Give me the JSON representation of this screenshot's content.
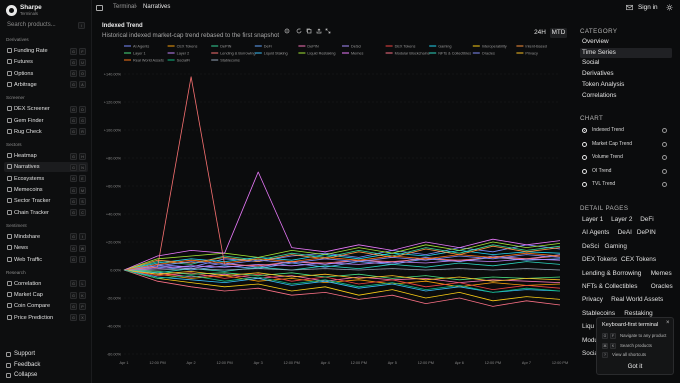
{
  "app": {
    "brand": "Sharpe",
    "brand_sub": "Terminals",
    "search_placeholder": "Search products...",
    "search_kbd": "/"
  },
  "sidebar": {
    "sections": [
      {
        "title": "Derivatives",
        "items": [
          {
            "label": "Funding Rate",
            "k1": "G",
            "k2": "F"
          },
          {
            "label": "Futures",
            "k1": "G",
            "k2": "U"
          },
          {
            "label": "Options",
            "k1": "G",
            "k2": "O"
          },
          {
            "label": "Arbitrage",
            "k1": "G",
            "k2": "A"
          }
        ]
      },
      {
        "title": "Screener",
        "items": [
          {
            "label": "DEX Screener",
            "k1": "G",
            "k2": "D"
          },
          {
            "label": "Gem Finder",
            "k1": "G",
            "k2": "G"
          },
          {
            "label": "Rug Check",
            "k1": "G",
            "k2": "R"
          }
        ]
      },
      {
        "title": "Sectors",
        "items": [
          {
            "label": "Heatmap",
            "k1": "G",
            "k2": "H"
          },
          {
            "label": "Narratives",
            "k1": "G",
            "k2": "N",
            "active": true
          },
          {
            "label": "Ecosystems",
            "k1": "G",
            "k2": "E"
          },
          {
            "label": "Memecoins",
            "k1": "G",
            "k2": "M"
          },
          {
            "label": "Sector Tracker",
            "k1": "G",
            "k2": "S"
          },
          {
            "label": "Chain Tracker",
            "k1": "G",
            "k2": "C"
          }
        ]
      },
      {
        "title": "Sentiment",
        "items": [
          {
            "label": "Mindshare",
            "k1": "G",
            "k2": "I"
          },
          {
            "label": "News",
            "k1": "G",
            "k2": "W"
          },
          {
            "label": "Web Traffic",
            "k1": "G",
            "k2": "T"
          }
        ]
      },
      {
        "title": "Research",
        "items": [
          {
            "label": "Correlation",
            "k1": "G",
            "k2": "L"
          },
          {
            "label": "Market Cap",
            "k1": "G",
            "k2": "K"
          },
          {
            "label": "Coin Compare",
            "k1": "G",
            "k2": "P"
          },
          {
            "label": "Price Prediction",
            "k1": "G",
            "k2": "X"
          }
        ]
      }
    ],
    "footer": [
      "Support",
      "Feedback",
      "Collapse"
    ]
  },
  "topbar": {
    "breadcrumb": [
      "Terminal",
      "Narratives"
    ],
    "signin": "Sign in"
  },
  "main": {
    "title": "Indexed Trend",
    "subtitle": "Historical indexed market-cap trend rebased to the first snapshot",
    "ranges": [
      "24H",
      "MTD"
    ]
  },
  "chart_data": {
    "type": "line",
    "x": [
      "Apr 1",
      "12:00 PM",
      "Apr 2",
      "12:00 PM",
      "Apr 3",
      "12:00 PM",
      "Apr 4",
      "12:00 PM",
      "Apr 5",
      "12:00 PM",
      "Apr 6",
      "12:00 PM",
      "Apr 7",
      "12:00 PM"
    ],
    "ylim": [
      -60,
      140
    ],
    "yticks": [
      "+140.00%",
      "+120.00%",
      "+100.00%",
      "+80.00%",
      "+60.00%",
      "+40.00%",
      "+20.00%",
      "0.00%",
      "-20.00%",
      "-40.00%",
      "-60.00%"
    ],
    "grid": true,
    "legend_position": "top",
    "series": [
      {
        "name": "AI Agents",
        "color": "#7b8cff",
        "values": [
          0,
          4,
          2,
          8,
          6,
          10,
          12,
          9,
          14,
          11,
          16,
          13,
          18,
          15
        ]
      },
      {
        "name": "CEX Tokens",
        "color": "#f59e0b",
        "values": [
          0,
          -3,
          -6,
          -4,
          -8,
          -6,
          -9,
          -7,
          -10,
          -8,
          -12,
          -9,
          -11,
          -10
        ]
      },
      {
        "name": "DePIN",
        "color": "#34d399",
        "values": [
          0,
          6,
          4,
          10,
          7,
          12,
          9,
          14,
          10,
          16,
          12,
          18,
          14,
          17
        ]
      },
      {
        "name": "DeFi",
        "color": "#60a5fa",
        "values": [
          0,
          2,
          0,
          3,
          1,
          5,
          2,
          6,
          4,
          8,
          6,
          9,
          7,
          8
        ]
      },
      {
        "name": "DePIN",
        "color": "#f472b6",
        "values": [
          0,
          -2,
          -5,
          -3,
          -6,
          -4,
          -8,
          -5,
          -7,
          -6,
          -9,
          -7,
          -8,
          -9
        ]
      },
      {
        "name": "DeSci",
        "color": "#a78bfa",
        "values": [
          0,
          3,
          1,
          5,
          2,
          6,
          4,
          7,
          5,
          9,
          6,
          10,
          8,
          11
        ]
      },
      {
        "name": "DEX Tokens",
        "color": "#ef4444",
        "values": [
          0,
          -4,
          -2,
          -6,
          -3,
          -8,
          -5,
          -10,
          -7,
          -12,
          -9,
          -14,
          -11,
          -13
        ]
      },
      {
        "name": "Gaming",
        "color": "#22d3ee",
        "values": [
          0,
          5,
          8,
          6,
          9,
          7,
          11,
          8,
          12,
          10,
          14,
          11,
          13,
          12
        ]
      },
      {
        "name": "Interoperability",
        "color": "#facc15",
        "values": [
          0,
          -6,
          -9,
          -12,
          -10,
          -15,
          -12,
          -18,
          -14,
          -20,
          -16,
          -22,
          -19,
          -21
        ]
      },
      {
        "name": "Intent-Based",
        "color": "#fb923c",
        "values": [
          0,
          7,
          5,
          9,
          6,
          11,
          8,
          13,
          9,
          15,
          11,
          17,
          13,
          16
        ]
      },
      {
        "name": "Layer 1",
        "color": "#4ade80",
        "values": [
          0,
          -1,
          -3,
          -2,
          -4,
          -2,
          -5,
          -3,
          -6,
          -4,
          -7,
          -5,
          -6,
          -5
        ]
      },
      {
        "name": "Layer 2",
        "color": "#c084fc",
        "values": [
          0,
          1,
          3,
          2,
          4,
          3,
          5,
          4,
          6,
          5,
          7,
          6,
          8,
          7
        ]
      },
      {
        "name": "Lending & Borrowing",
        "color": "#f87171",
        "values": [
          0,
          2,
          138,
          4,
          3,
          6,
          5,
          7,
          6,
          8,
          7,
          9,
          8,
          10
        ]
      },
      {
        "name": "Liquid Staking",
        "color": "#38bdf8",
        "values": [
          0,
          -5,
          -7,
          -9,
          -6,
          -11,
          -8,
          -13,
          -10,
          -15,
          -12,
          -16,
          -14,
          -15
        ]
      },
      {
        "name": "Liquid Restaking",
        "color": "#a3e635",
        "values": [
          0,
          8,
          10,
          12,
          9,
          14,
          11,
          16,
          12,
          18,
          14,
          20,
          16,
          19
        ]
      },
      {
        "name": "Memes",
        "color": "#e879f9",
        "values": [
          0,
          10,
          14,
          12,
          70,
          16,
          13,
          18,
          14,
          20,
          16,
          22,
          18,
          21
        ]
      },
      {
        "name": "Modular Blockchains",
        "color": "#fb7185",
        "values": [
          0,
          -8,
          -12,
          -15,
          -13,
          -18,
          -16,
          -21,
          -18,
          -24,
          -20,
          -26,
          -22,
          -25
        ]
      },
      {
        "name": "NFTs & Collectibles",
        "color": "#2dd4bf",
        "values": [
          0,
          -2,
          1,
          -1,
          2,
          0,
          3,
          1,
          4,
          2,
          5,
          3,
          6,
          4
        ]
      },
      {
        "name": "Oracles",
        "color": "#818cf8",
        "values": [
          0,
          3,
          6,
          4,
          7,
          5,
          8,
          6,
          9,
          7,
          10,
          8,
          11,
          9
        ]
      },
      {
        "name": "Privacy",
        "color": "#fbbf24",
        "values": [
          0,
          -3,
          -1,
          -4,
          -2,
          -5,
          -3,
          -6,
          -4,
          -7,
          -5,
          -8,
          -6,
          -7
        ]
      },
      {
        "name": "Real World Assets",
        "color": "#f97316",
        "values": [
          0,
          4,
          7,
          5,
          8,
          6,
          9,
          7,
          10,
          8,
          11,
          9,
          12,
          10
        ]
      },
      {
        "name": "SocialFi",
        "color": "#10b981",
        "values": [
          0,
          -6,
          -4,
          -8,
          -5,
          -10,
          -7,
          -12,
          -9,
          -14,
          -11,
          -16,
          -13,
          -15
        ]
      },
      {
        "name": "Stablecoins",
        "color": "#94a3b8",
        "values": [
          0,
          0,
          1,
          0,
          1,
          0,
          1,
          0,
          1,
          0,
          1,
          0,
          1,
          0
        ]
      }
    ]
  },
  "rpanel": {
    "category_title": "CATEGORY",
    "categories": [
      "Overview",
      "Time Series",
      "Social",
      "Derivatives",
      "Token Analysis",
      "Correlations"
    ],
    "active_category": "Time Series",
    "chart_title": "CHART",
    "charts": [
      "Indexed Trend",
      "Market Cap Trend",
      "Volume Trend",
      "OI Trend",
      "TVL Trend"
    ],
    "active_chart": "Indexed Trend",
    "detail_title": "DETAIL PAGES",
    "detail_rows": [
      [
        "Layer 1",
        "Layer 2",
        "DeFi"
      ],
      [
        "AI Agents",
        "DeAI",
        "DePIN"
      ],
      [
        "DeSci",
        "Gaming"
      ],
      [
        "DEX Tokens",
        "CEX Tokens"
      ],
      [
        "Lending & Borrowing",
        "Memes"
      ],
      [
        "NFTs & Collectibles",
        "Oracles"
      ],
      [
        "Privacy",
        "Real World Assets"
      ],
      [
        "Stablecoins",
        "Restaking"
      ],
      [
        "Liqu"
      ],
      [
        "Modu"
      ],
      [
        "Socia"
      ]
    ]
  },
  "popup": {
    "title": "Keyboard-first terminal",
    "rows": [
      {
        "k": [
          "G",
          "F"
        ],
        "text": "Navigate to any product"
      },
      {
        "k": [
          "⌘",
          "K"
        ],
        "text": "Search products"
      },
      {
        "k": [
          "?"
        ],
        "text": "View all shortcuts"
      }
    ],
    "button": "Got it",
    "close": "×"
  }
}
